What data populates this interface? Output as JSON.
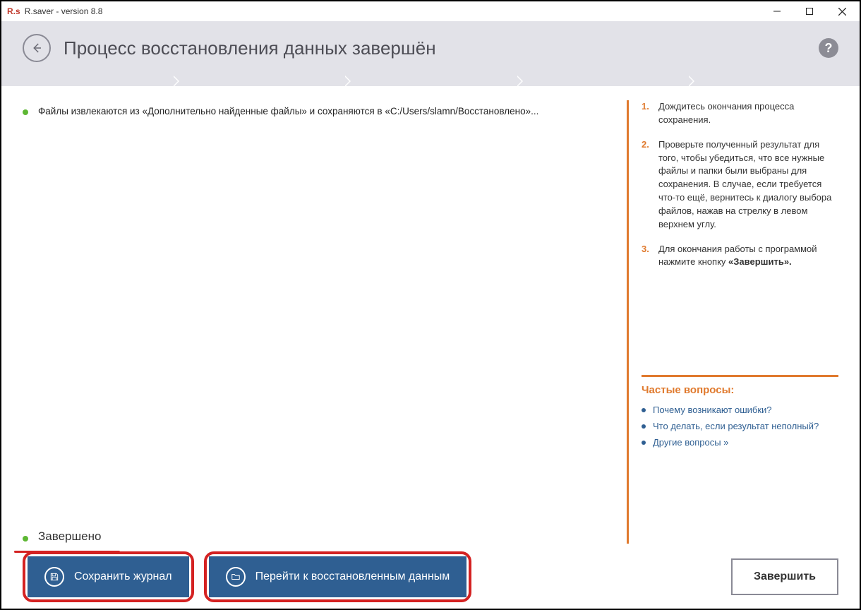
{
  "titlebar": {
    "app_icon_text": "R.s",
    "title": "R.saver - version 8.8"
  },
  "header": {
    "page_title": "Процесс восстановления данных завершён"
  },
  "log": {
    "line1": "Файлы извлекаются из «Дополнительно найденные файлы» и сохраняются в «C:/Users/slamn/Восстановлено»...",
    "completed": "Завершено"
  },
  "instructions": {
    "items": [
      {
        "num": "1.",
        "text": "Дождитесь окончания процесса сохранения."
      },
      {
        "num": "2.",
        "text": "Проверьте полученный результат для того, чтобы убедиться, что все нужные файлы и папки были выбраны для сохранения. В случае, если требуется что-то ещё, вернитесь к диалогу выбора файлов, нажав на стрелку в левом верхнем углу."
      },
      {
        "num": "3.",
        "text_prefix": "Для окончания работы с программой нажмите кнопку ",
        "text_bold": "«Завершить».",
        "text_suffix": ""
      }
    ]
  },
  "faq": {
    "heading": "Частые вопросы:",
    "links": [
      "Почему возникают ошибки?",
      "Что делать, если результат неполный?",
      "Другие вопросы »"
    ]
  },
  "footer": {
    "save_log": "Сохранить журнал",
    "goto_data": "Перейти к восстановленным данным",
    "finish": "Завершить"
  }
}
